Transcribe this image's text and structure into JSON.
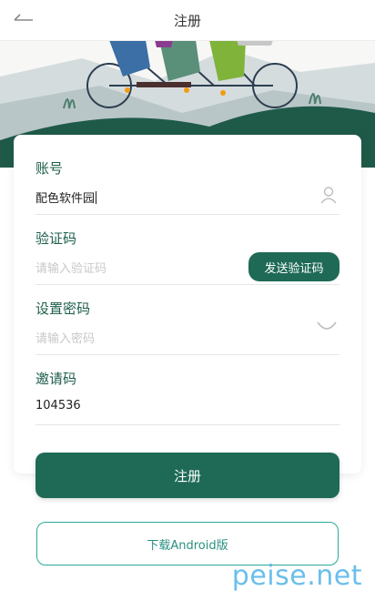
{
  "header": {
    "title": "注册"
  },
  "form": {
    "account": {
      "label": "账号",
      "value": "配色软件园"
    },
    "code": {
      "label": "验证码",
      "placeholder": "请输入验证码",
      "send_label": "发送验证码"
    },
    "password": {
      "label": "设置密码",
      "placeholder": "请输入密码"
    },
    "invite": {
      "label": "邀请码",
      "value": "104536"
    }
  },
  "actions": {
    "register_label": "注册",
    "download_label": "下载Android版"
  },
  "watermark": "peise.net",
  "colors": {
    "primary": "#1e6a56",
    "outline": "#2aa99a",
    "watermark": "#5bb8e8"
  },
  "icons": {
    "back": "arrow-left-icon",
    "user": "user-icon",
    "eye": "eye-closed-icon"
  }
}
